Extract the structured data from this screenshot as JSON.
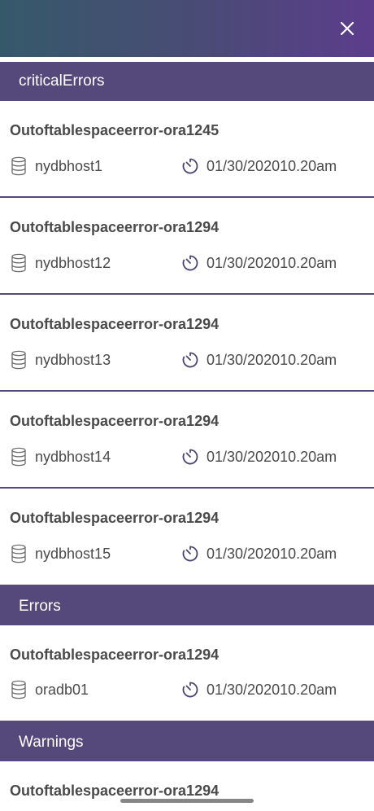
{
  "topbar": {
    "close_icon": "close-icon"
  },
  "sections": [
    {
      "title": "criticalErrors",
      "items": [
        {
          "title": "Outoftablespaceerror-ora1245",
          "host": "nydbhost1",
          "time": "01/30/202010.20am"
        },
        {
          "title": "Outoftablespaceerror-ora1294",
          "host": "nydbhost12",
          "time": "01/30/202010.20am"
        },
        {
          "title": "Outoftablespaceerror-ora1294",
          "host": "nydbhost13",
          "time": "01/30/202010.20am"
        },
        {
          "title": "Outoftablespaceerror-ora1294",
          "host": "nydbhost14",
          "time": "01/30/202010.20am"
        },
        {
          "title": "Outoftablespaceerror-ora1294",
          "host": "nydbhost15",
          "time": "01/30/202010.20am"
        }
      ]
    },
    {
      "title": "Errors",
      "items": [
        {
          "title": "Outoftablespaceerror-ora1294",
          "host": "oradb01",
          "time": "01/30/202010.20am"
        }
      ]
    },
    {
      "title": "Warnings",
      "items": [
        {
          "title": "Outoftablespaceerror-ora1294"
        }
      ]
    }
  ],
  "icons": {
    "host": "database-icon",
    "time": "timer-icon"
  },
  "colors": {
    "header_bg": "#54497a",
    "gradient_start": "#36596a",
    "gradient_end": "#5c3d8c"
  }
}
